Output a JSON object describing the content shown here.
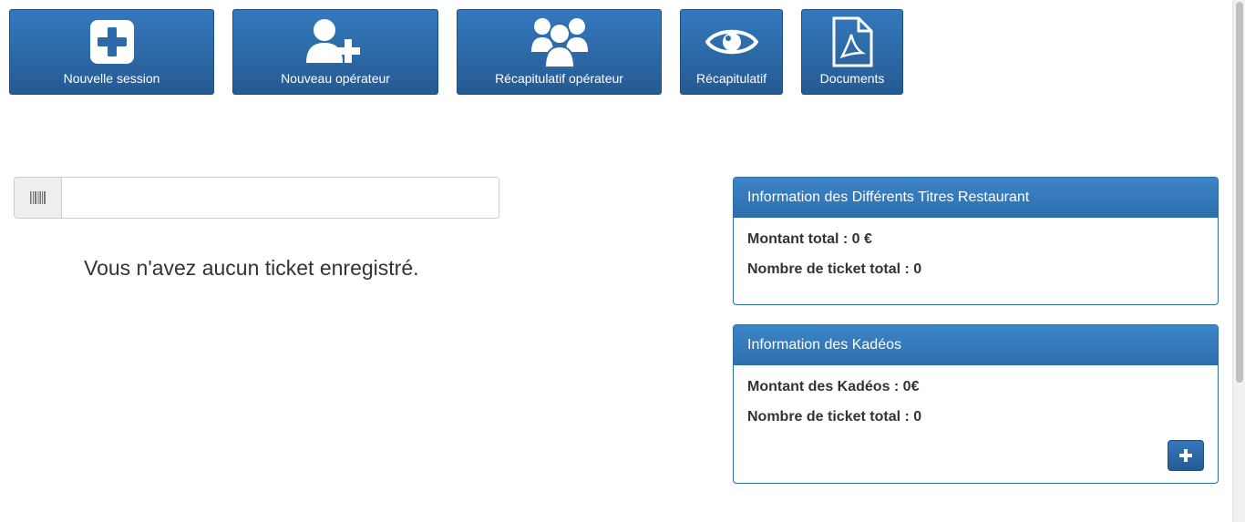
{
  "toolbar": {
    "new_session": {
      "label": "Nouvelle session",
      "icon": "plus-square-icon"
    },
    "new_operator": {
      "label": "Nouveau opérateur",
      "icon": "add-user-icon"
    },
    "operator_summary": {
      "label": "Récapitulatif opérateur",
      "icon": "users-group-icon"
    },
    "summary": {
      "label": "Récapitulatif",
      "icon": "eye-icon"
    },
    "documents": {
      "label": "Documents",
      "icon": "pdf-document-icon"
    }
  },
  "scan": {
    "icon": "barcode-icon",
    "value": "",
    "placeholder": ""
  },
  "tickets": {
    "empty_message": "Vous n'avez aucun ticket enregistré."
  },
  "panels": {
    "titres_restaurant": {
      "title": "Information des Différents Titres Restaurant",
      "total_amount": "Montant total : 0 €",
      "total_count": "Nombre de ticket total : 0"
    },
    "kadeos": {
      "title": "Information des Kadéos",
      "total_amount": "Montant des Kadéos : 0€",
      "total_count": "Nombre de ticket total : 0",
      "add_icon": "plus-icon"
    }
  },
  "colors": {
    "primary": "#2d6aa8",
    "primary_dark": "#1f4e82",
    "panel_border": "#2e6da4"
  }
}
